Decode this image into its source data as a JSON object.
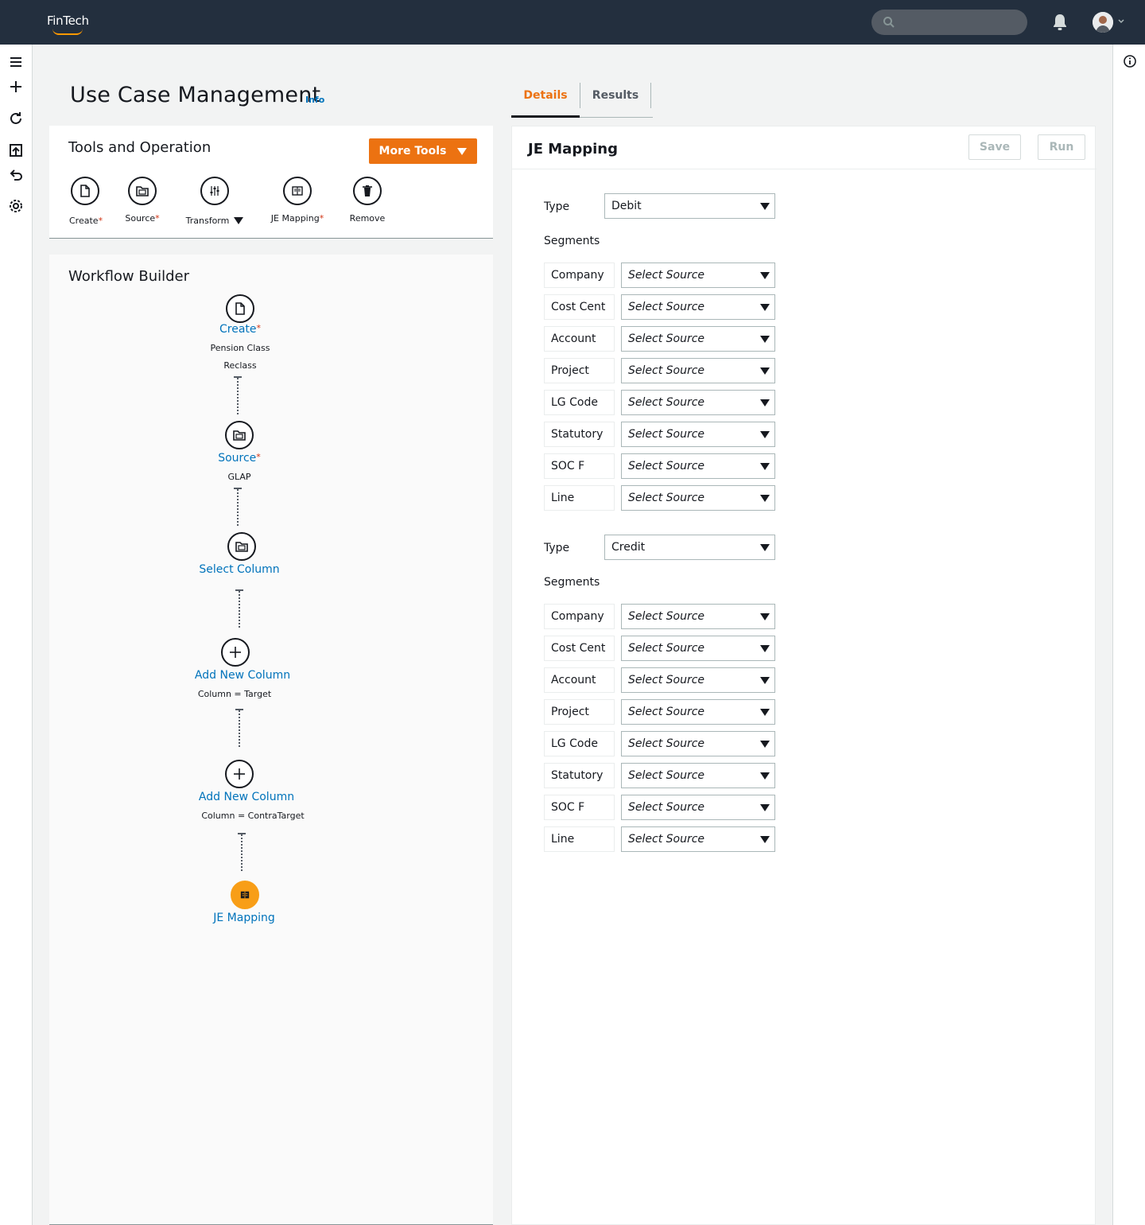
{
  "app": {
    "brand": "FinTech"
  },
  "page": {
    "title": "Use Case Management",
    "info_label": "Info"
  },
  "tabs": [
    {
      "label": "Details"
    },
    {
      "label": "Results"
    }
  ],
  "tools": {
    "title": "Tools and Operation",
    "more_tools_label": "More Tools",
    "items": [
      {
        "label": "Create",
        "icon": "file-icon",
        "required": "*"
      },
      {
        "label": "Source",
        "icon": "folder-icon",
        "required": "*"
      },
      {
        "label": "Transform",
        "icon": "sliders-icon"
      },
      {
        "label": "JE Mapping",
        "icon": "book-icon",
        "required": "*"
      },
      {
        "label": "Remove",
        "icon": "trash-icon"
      }
    ]
  },
  "workflow": {
    "title": "Workflow Builder",
    "nodes": [
      {
        "label": "Create",
        "required": "*",
        "sub1": "Pension Class",
        "sub2": "Reclass"
      },
      {
        "label": "Source",
        "required": "*",
        "sub1": "GLAP"
      },
      {
        "label": "Select Column"
      },
      {
        "label": "Add New Column",
        "sub1": "Column = Target"
      },
      {
        "label": "Add New Column",
        "sub1": "Column = ContraTarget"
      },
      {
        "label": "JE Mapping"
      }
    ]
  },
  "je_mapping": {
    "title": "JE Mapping",
    "save_label": "Save",
    "run_label": "Run",
    "type_label": "Type",
    "segments_label": "Segments",
    "source_placeholder": "Select Source",
    "debit": {
      "type_value": "Debit",
      "segments": [
        "Company",
        "Cost Cent",
        "Account",
        "Project",
        "LG Code",
        "Statutory",
        "SOC F",
        "Line"
      ]
    },
    "credit": {
      "type_value": "Credit",
      "segments": [
        "Company",
        "Cost Cent",
        "Account",
        "Project",
        "LG Code",
        "Statutory",
        "SOC F",
        "Line"
      ]
    }
  },
  "colors": {
    "accent": "#ec7211",
    "link": "#0073bb",
    "topbar": "#232f3e",
    "active_node": "#f89e17"
  }
}
